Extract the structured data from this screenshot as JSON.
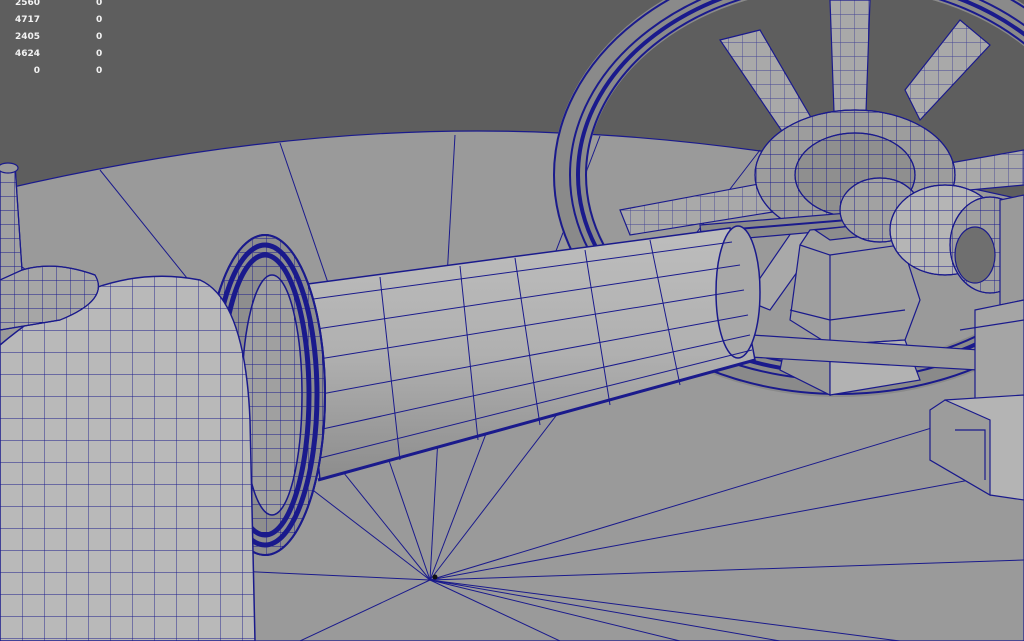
{
  "viewport": {
    "background_color": "#5e5e5e",
    "wireframe_color": "#1a1a8c",
    "mesh_fill_color": "#a9a9a9"
  },
  "hud": {
    "rows": [
      {
        "count": "2560",
        "selected": "0"
      },
      {
        "count": "4717",
        "selected": "0"
      },
      {
        "count": "2405",
        "selected": "0"
      },
      {
        "count": "4624",
        "selected": "0"
      },
      {
        "count": "0",
        "selected": "0"
      }
    ]
  }
}
